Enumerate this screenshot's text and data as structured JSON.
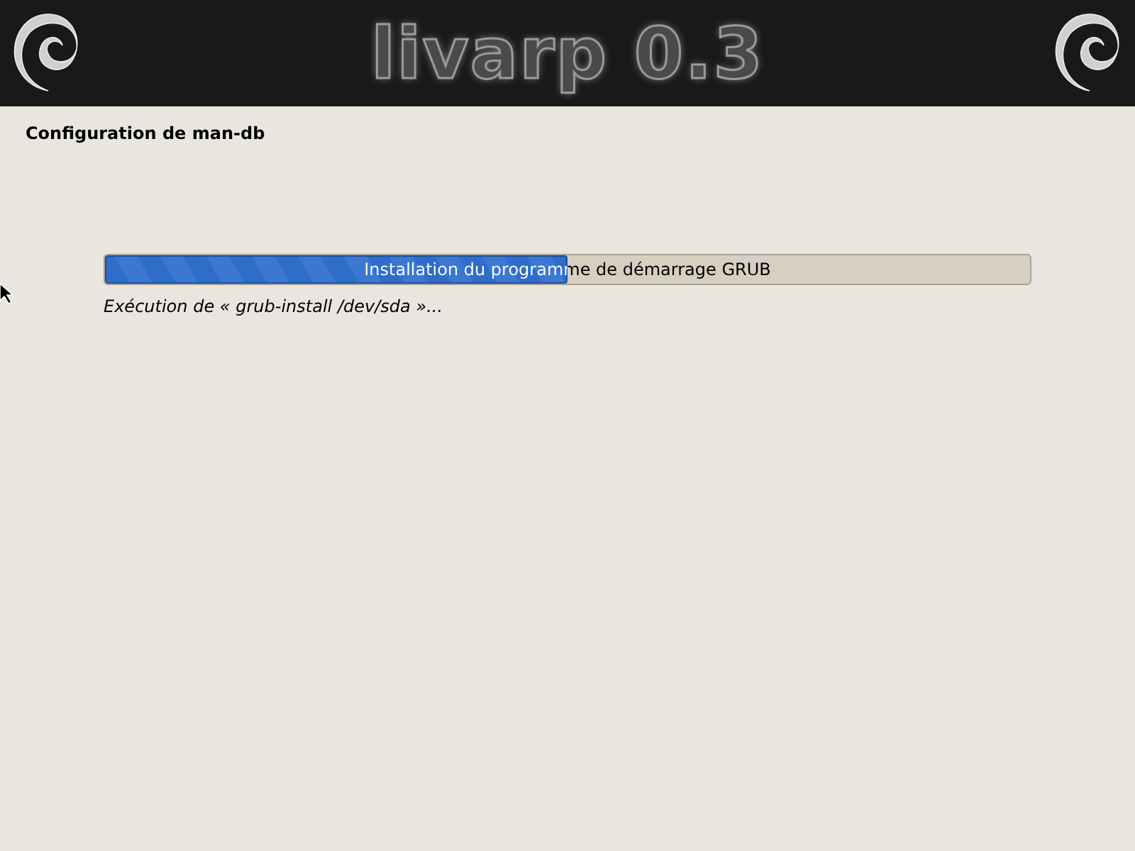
{
  "banner": {
    "title": "livarp 0.3"
  },
  "dialog_title": "Configuration de man-db",
  "progress": {
    "label": "Installation du programme de démarrage GRUB",
    "level": 0.5
  },
  "status": "Exécution de « grub-install /dev/sda »..."
}
